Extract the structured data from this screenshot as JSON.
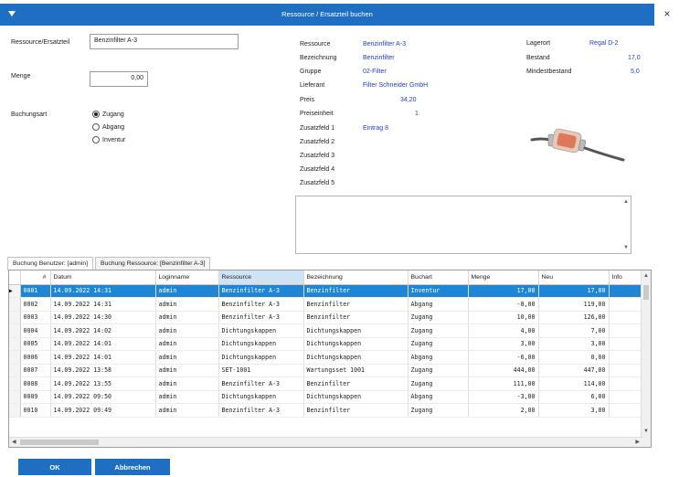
{
  "window": {
    "title": "Ressource / Ersatzteil buchen",
    "close": "×"
  },
  "form": {
    "ressource_label": "Ressource/Ersatzteil",
    "ressource_value": "Benzinfilter A-3",
    "menge_label": "Menge",
    "menge_value": "0,00",
    "buchungsart_label": "Buchungsart",
    "radio": [
      {
        "label": "Zugang",
        "checked": true
      },
      {
        "label": "Abgang",
        "checked": false
      },
      {
        "label": "Inventur",
        "checked": false
      }
    ]
  },
  "info": {
    "rows": [
      {
        "label": "Ressource",
        "value": "Benzinfilter A-3"
      },
      {
        "label": "Bezeichnung",
        "value": "Benzinfilter"
      },
      {
        "label": "Gruppe",
        "value": "02-Filter"
      },
      {
        "label": "Lieferant",
        "value": "Filter Schneider GmbH"
      },
      {
        "label": "Preis",
        "value": "34,20"
      },
      {
        "label": "Preiseinheit",
        "value": "1"
      },
      {
        "label": "Zusatzfeld 1",
        "value": "Eintrag 8"
      },
      {
        "label": "Zusatzfeld 2",
        "value": ""
      },
      {
        "label": "Zusatzfeld 3",
        "value": ""
      },
      {
        "label": "Zusatzfeld 4",
        "value": ""
      },
      {
        "label": "Zusatzfeld 5",
        "value": ""
      }
    ],
    "stock": [
      {
        "label": "Lagerort",
        "value": "Regal D-2"
      },
      {
        "label": "Bestand",
        "value": "17,0"
      },
      {
        "label": "Mindestbestand",
        "value": "5,0"
      }
    ]
  },
  "tabs": [
    {
      "label": "Buchung Benutzer: [admin]",
      "active": true
    },
    {
      "label": "Buchung Ressource: [Benzinfilter A-3]",
      "active": false
    }
  ],
  "grid": {
    "columns": [
      "#",
      "Datum",
      "Loginname",
      "Ressource",
      "Bezeichnung",
      "Buchart",
      "Menge",
      "Neu",
      "Info"
    ],
    "rows": [
      [
        "0001",
        "14.09.2022 14:31",
        "admin",
        "Benzinfilter A-3",
        "Benzinfilter",
        "Inventur",
        "17,00",
        "17,00",
        ""
      ],
      [
        "0002",
        "14.09.2022 14:31",
        "admin",
        "Benzinfilter A-3",
        "Benzinfilter",
        "Abgang",
        "-8,00",
        "119,00",
        ""
      ],
      [
        "0003",
        "14.09.2022 14:30",
        "admin",
        "Benzinfilter A-3",
        "Benzinfilter",
        "Zugang",
        "10,00",
        "126,00",
        ""
      ],
      [
        "0004",
        "14.09.2022 14:02",
        "admin",
        "Dichtungskappen",
        "Dichtungskappen",
        "Zugang",
        "4,00",
        "7,00",
        ""
      ],
      [
        "0005",
        "14.09.2022 14:01",
        "admin",
        "Dichtungskappen",
        "Dichtungskappen",
        "Zugang",
        "3,00",
        "3,00",
        ""
      ],
      [
        "0006",
        "14.09.2022 14:01",
        "admin",
        "Dichtungskappen",
        "Dichtungskappen",
        "Abgang",
        "-6,00",
        "0,00",
        ""
      ],
      [
        "0007",
        "14.09.2022 13:58",
        "admin",
        "SET-1001",
        "Wartungsset 1001",
        "Zugang",
        "444,00",
        "447,00",
        ""
      ],
      [
        "0008",
        "14.09.2022 13:55",
        "admin",
        "Benzinfilter A-3",
        "Benzinfilter",
        "Zugang",
        "111,00",
        "114,00",
        ""
      ],
      [
        "0009",
        "14.09.2022 09:50",
        "admin",
        "Dichtungskappen",
        "Dichtungskappen",
        "Abgang",
        "-3,00",
        "6,00",
        ""
      ],
      [
        "0010",
        "14.09.2022 09:49",
        "admin",
        "Benzinfilter A-3",
        "Benzinfilter",
        "Zugang",
        "2,00",
        "3,00",
        ""
      ]
    ],
    "selected_row": 0
  },
  "buttons": {
    "ok": "OK",
    "cancel": "Abbrechen"
  },
  "colors": {
    "accent": "#1e6fc2",
    "selection": "#1e86d6",
    "value_text": "#1f3fd1"
  }
}
